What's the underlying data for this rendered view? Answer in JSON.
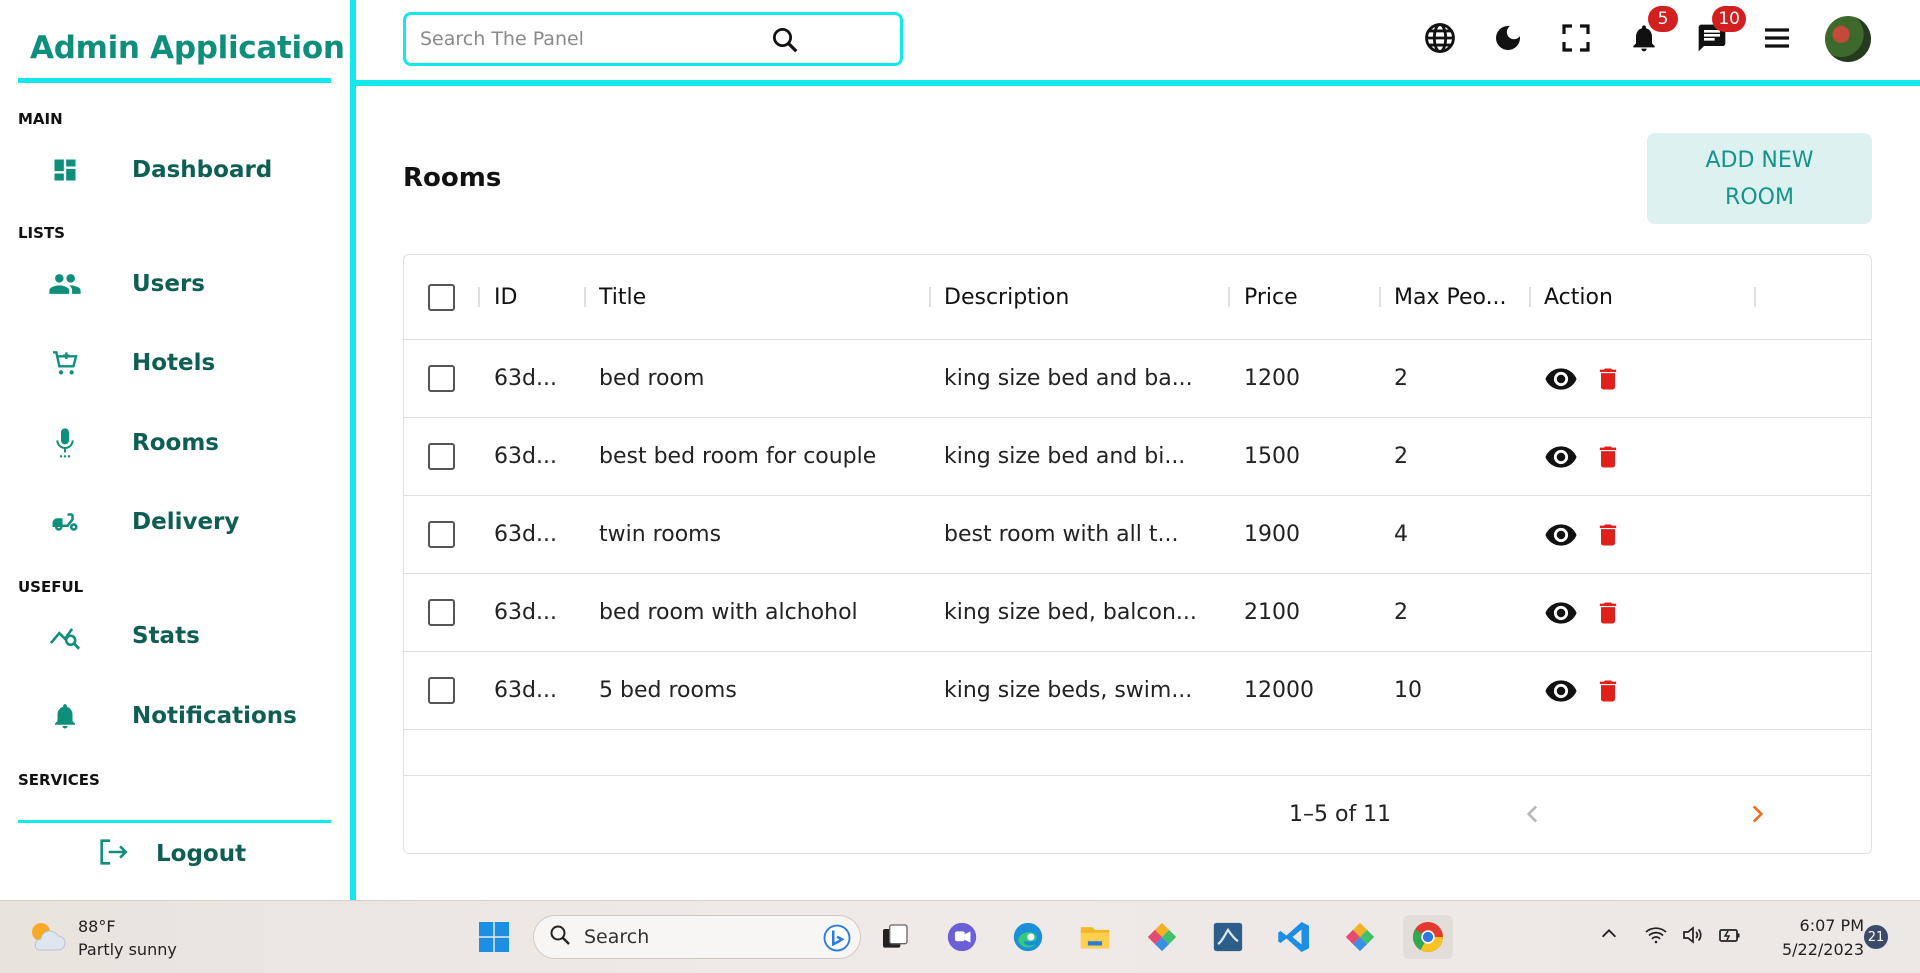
{
  "app": {
    "title": "Admin Application"
  },
  "sidebar": {
    "sections": {
      "main": "MAIN",
      "lists": "LISTS",
      "useful": "USEFUL",
      "services": "SERVICES"
    },
    "items": [
      {
        "label": "Dashboard",
        "icon": "dashboard-icon"
      },
      {
        "label": "Users",
        "icon": "users-icon"
      },
      {
        "label": "Hotels",
        "icon": "cart-icon"
      },
      {
        "label": "Rooms",
        "icon": "microphone-icon"
      },
      {
        "label": "Delivery",
        "icon": "delivery-icon"
      },
      {
        "label": "Stats",
        "icon": "stats-icon"
      },
      {
        "label": "Notifications",
        "icon": "bell-icon"
      }
    ],
    "logout": "Logout"
  },
  "topbar": {
    "search_placeholder": "Search The Panel",
    "notifications_count": "5",
    "messages_count": "10"
  },
  "page": {
    "title": "Rooms",
    "add_button": "ADD NEW ROOM"
  },
  "grid": {
    "columns": [
      "ID",
      "Title",
      "Description",
      "Price",
      "Max Peo...",
      "Action"
    ],
    "rows": [
      {
        "id": "63d...",
        "title": "bed room",
        "description": "king size bed and ba...",
        "price": "1200",
        "max": "2"
      },
      {
        "id": "63d...",
        "title": "best bed room for couple",
        "description": "king size bed and bi...",
        "price": "1500",
        "max": "2"
      },
      {
        "id": "63d...",
        "title": "twin rooms",
        "description": "best room with all t...",
        "price": "1900",
        "max": "4"
      },
      {
        "id": "63d...",
        "title": "bed room with alchohol",
        "description": "king size bed, balcon...",
        "price": "2100",
        "max": "2"
      },
      {
        "id": "63d...",
        "title": "5 bed rooms",
        "description": "king size beds, swim...",
        "price": "12000",
        "max": "10"
      }
    ],
    "pagination": "1–5 of 11"
  },
  "taskbar": {
    "weather_temp": "88°F",
    "weather_desc": "Partly sunny",
    "search_label": "Search",
    "time": "6:07 PM",
    "date": "5/22/2023",
    "notification_count": "21"
  },
  "colors": {
    "accent": "#14e8ec",
    "brand": "#0e8f7b",
    "danger": "#e0201b"
  }
}
